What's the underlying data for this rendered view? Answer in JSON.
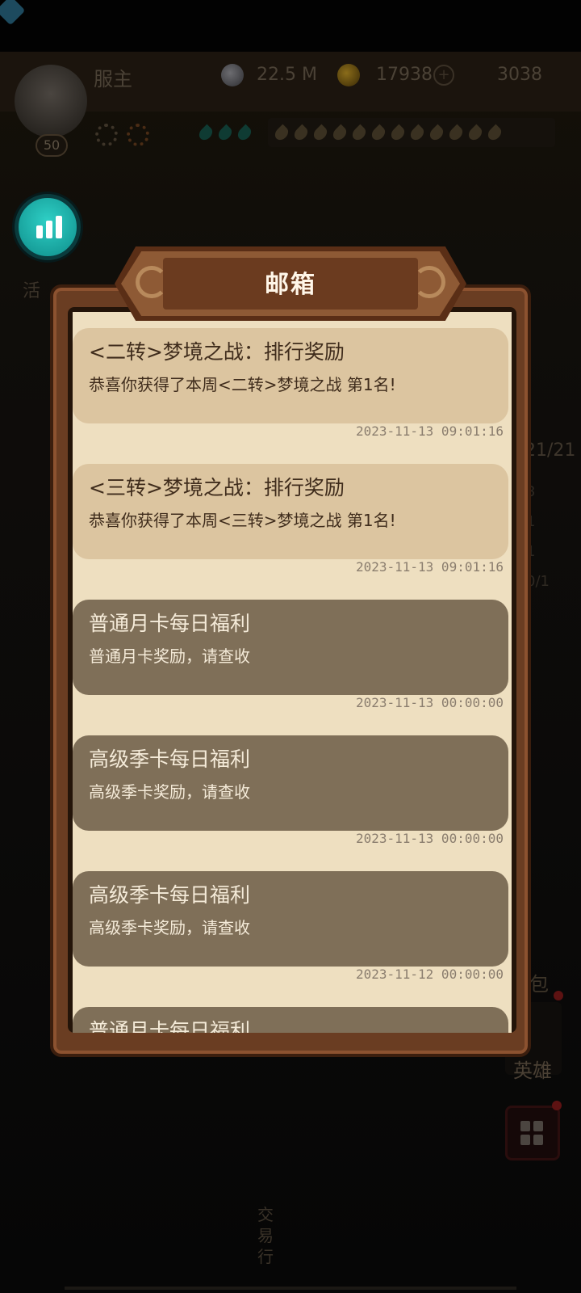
{
  "hud": {
    "server_label": "服主",
    "silver": "22.5 M",
    "gold": "17938",
    "gems": "3038",
    "add_symbol": "+",
    "level": "50"
  },
  "side": {
    "left_button_label": "活",
    "counter": "21/21",
    "stats_col": [
      "3",
      "1",
      "1",
      "0/1"
    ],
    "bag_label": "包",
    "hero_label": "英雄",
    "trade_label": "交易行"
  },
  "mailbox": {
    "title": "邮箱",
    "mails": [
      {
        "subject": "<二转>梦境之战：排行奖励",
        "body": "恭喜你获得了本周<二转>梦境之战 第1名!",
        "time": "2023-11-13 09:01:16",
        "read": true
      },
      {
        "subject": "<三转>梦境之战：排行奖励",
        "body": "恭喜你获得了本周<三转>梦境之战 第1名!",
        "time": "2023-11-13 09:01:16",
        "read": true
      },
      {
        "subject": "普通月卡每日福利",
        "body": "普通月卡奖励，请查收",
        "time": "2023-11-13 00:00:00",
        "read": false
      },
      {
        "subject": "高级季卡每日福利",
        "body": "高级季卡奖励，请查收",
        "time": "2023-11-13 00:00:00",
        "read": false
      },
      {
        "subject": "高级季卡每日福利",
        "body": "高级季卡奖励，请查收",
        "time": "2023-11-12 00:00:00",
        "read": false
      },
      {
        "subject": "普通月卡每日福利",
        "body": "",
        "time": "",
        "read": false
      }
    ]
  },
  "colors": {
    "accent_teal": "#1fb4ae",
    "dialog_frame": "#6a3d22",
    "paper": "#eedfc0",
    "card_read": "#dcc5a0",
    "card_unread": "#7f6f58"
  },
  "icons": [
    "stats-icon",
    "silver-coin-icon",
    "gold-coin-icon",
    "diamond-icon",
    "gear-icon",
    "energy-drop-icon",
    "grid-menu-icon"
  ]
}
